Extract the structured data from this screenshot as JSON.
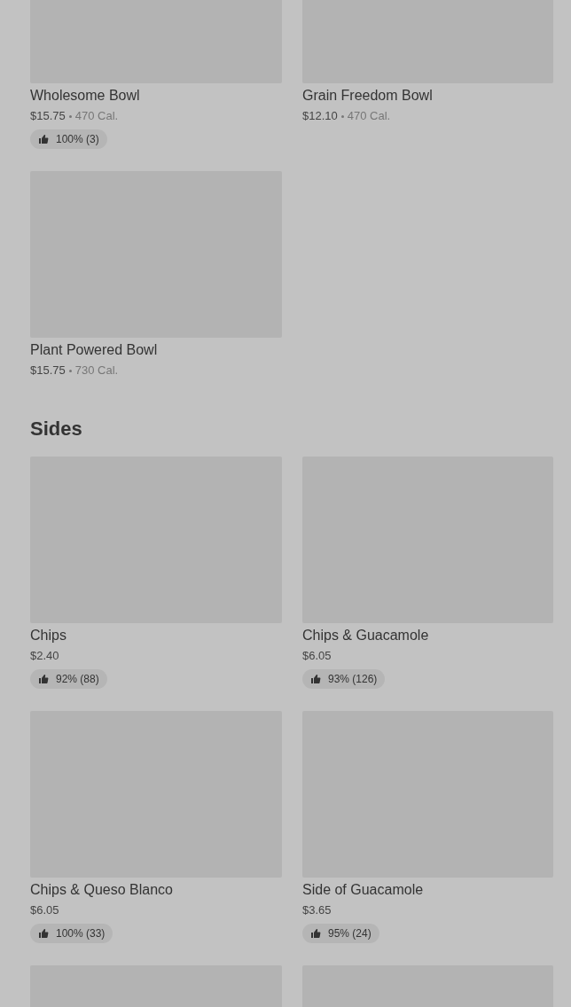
{
  "sections": [
    {
      "items": [
        {
          "name": "Wholesome Bowl",
          "price": "$15.75",
          "calories": "470 Cal.",
          "rating": "100% (3)"
        },
        {
          "name": "Grain Freedom Bowl",
          "price": "$12.10",
          "calories": "470 Cal."
        },
        {
          "name": "Plant Powered Bowl",
          "price": "$15.75",
          "calories": "730 Cal."
        }
      ]
    },
    {
      "title": "Sides",
      "items": [
        {
          "name": "Chips",
          "price": "$2.40",
          "rating": "92% (88)"
        },
        {
          "name": "Chips & Guacamole",
          "price": "$6.05",
          "rating": "93% (126)"
        },
        {
          "name": "Chips & Queso Blanco",
          "price": "$6.05",
          "rating": "100% (33)"
        },
        {
          "name": "Side of Guacamole",
          "price": "$3.65",
          "rating": "95% (24)"
        },
        {
          "kind": "picture"
        },
        {
          "kind": "picture"
        }
      ]
    }
  ]
}
